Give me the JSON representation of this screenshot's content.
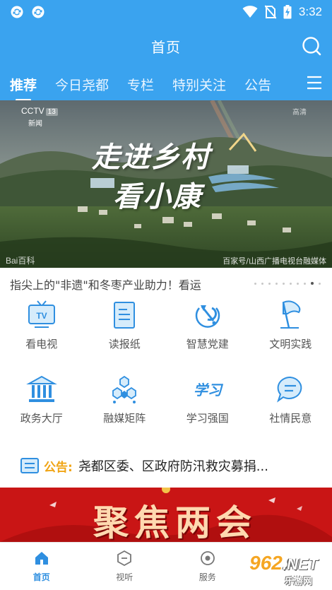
{
  "status_bar": {
    "time": "3:32",
    "left_icons": [
      "sync-icon",
      "sync-icon"
    ],
    "right_icons": [
      "wifi-icon",
      "no-sim-icon",
      "battery-charging-icon"
    ]
  },
  "header": {
    "title": "首页",
    "bg_color": "#3AA3EF",
    "search_icon": "search-icon"
  },
  "tabs": [
    {
      "label": "推荐",
      "active": true
    },
    {
      "label": "今日尧都",
      "active": false
    },
    {
      "label": "专栏",
      "active": false
    },
    {
      "label": "特别关注",
      "active": false
    },
    {
      "label": "公告",
      "active": false
    }
  ],
  "tabs_menu_icon": "menu-icon",
  "banner": {
    "cctv_logo": "CCTV",
    "cctv_channel": "13",
    "cctv_sub": "新闻",
    "title_line1": "走进乡村",
    "title_line2": "看小康",
    "corner_mark": "高清",
    "baidu_mark": "Bai百科",
    "watermark": "百家号/山西广播电视台融媒体"
  },
  "carousel": {
    "caption": "指尖上的\"非遗\"和冬枣产业助力！看运",
    "dot_count": 10,
    "active_dot": 8
  },
  "grid": [
    {
      "label": "看电视",
      "icon": "tv-icon"
    },
    {
      "label": "读报纸",
      "icon": "newspaper-icon"
    },
    {
      "label": "智慧党建",
      "icon": "party-emblem-icon"
    },
    {
      "label": "文明实践",
      "icon": "flag-icon"
    },
    {
      "label": "政务大厅",
      "icon": "government-hall-icon"
    },
    {
      "label": "融媒矩阵",
      "icon": "media-matrix-icon"
    },
    {
      "label": "学习强国",
      "icon": "xuexi-logo-icon"
    },
    {
      "label": "社情民意",
      "icon": "chat-bubble-icon"
    }
  ],
  "notice": {
    "tag": "公告:",
    "text": "尧都区委、区政府防汛救灾募捐..."
  },
  "promo": {
    "title": "聚焦两会",
    "bg_color": "#c91515"
  },
  "bottom_nav": [
    {
      "label": "首页",
      "icon": "home-icon",
      "active": true
    },
    {
      "label": "视听",
      "icon": "video-icon",
      "active": false
    },
    {
      "label": "服务",
      "icon": "service-icon",
      "active": false
    },
    {
      "label": "",
      "icon": "user-icon",
      "active": false
    }
  ],
  "site_watermark": {
    "brand": "962",
    "brand_suffix": ".NET",
    "subtitle": "乐游网"
  },
  "colors": {
    "accent": "#3AA3EF",
    "icon_blue": "#2f8fe0",
    "notice_orange": "#f0a414",
    "promo_red": "#c91515"
  }
}
